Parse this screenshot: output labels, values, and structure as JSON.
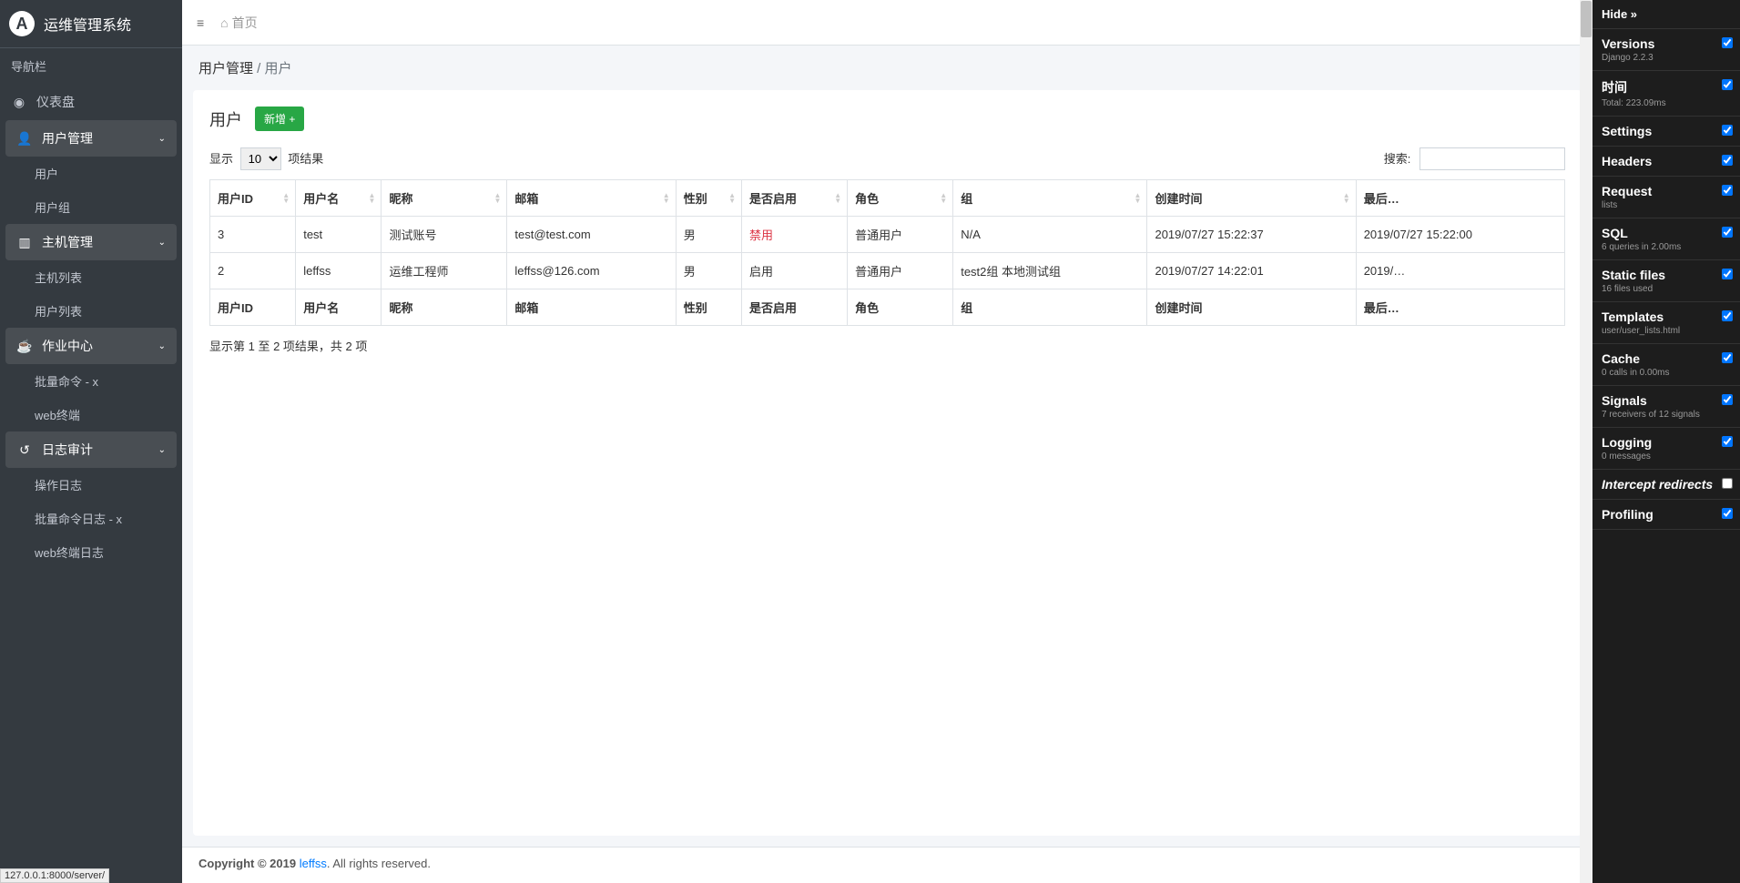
{
  "brand": {
    "title": "运维管理系统"
  },
  "nav_header": "导航栏",
  "nav": {
    "dashboard": "仪表盘",
    "user_mgmt": "用户管理",
    "user_mgmt_items": {
      "users": "用户",
      "groups": "用户组"
    },
    "host_mgmt": "主机管理",
    "host_mgmt_items": {
      "host_list": "主机列表",
      "user_list": "用户列表"
    },
    "job_center": "作业中心",
    "job_center_items": {
      "batch_cmd": "批量命令 - x",
      "web_term": "web终端"
    },
    "log_audit": "日志审计",
    "log_audit_items": {
      "op_log": "操作日志",
      "batch_cmd_log": "批量命令日志 - x",
      "web_term_log": "web终端日志"
    }
  },
  "topbar": {
    "home": "首页"
  },
  "breadcrumb": {
    "parent": "用户管理",
    "sep": " / ",
    "current": "用户"
  },
  "page": {
    "title": "用户",
    "add_btn": "新增 +",
    "show_label_pre": "显示",
    "show_value": "10",
    "show_label_post": "项结果",
    "search_label": "搜索:",
    "info": "显示第 1 至 2 项结果，共 2 项"
  },
  "table": {
    "headers": {
      "user_id": "用户ID",
      "username": "用户名",
      "nickname": "昵称",
      "email": "邮箱",
      "gender": "性别",
      "enabled": "是否启用",
      "role": "角色",
      "group": "组",
      "created": "创建时间",
      "last": "最后…"
    },
    "rows": [
      {
        "user_id": "3",
        "username": "test",
        "nickname": "测试账号",
        "email": "test@test.com",
        "gender": "男",
        "enabled": "禁用",
        "enabled_class": "status-disabled",
        "role": "普通用户",
        "group": "N/A",
        "created": "2019/07/27 15:22:37",
        "last": "2019/07/27 15:22:00"
      },
      {
        "user_id": "2",
        "username": "leffss",
        "nickname": "运维工程师",
        "email": "leffss@126.com",
        "gender": "男",
        "enabled": "启用",
        "enabled_class": "",
        "role": "普通用户",
        "group": "test2组 本地测试组",
        "created": "2019/07/27 14:22:01",
        "last": "2019/…"
      }
    ]
  },
  "footer": {
    "copyright_pre": "Copyright © 2019 ",
    "link": "leffss",
    "copyright_post": ". All rights reserved."
  },
  "status_url": "127.0.0.1:8000/server/",
  "debug": {
    "hide": "Hide »",
    "sections": [
      {
        "title": "Versions",
        "sub": "Django 2.2.3",
        "check": true
      },
      {
        "title": "时间",
        "sub": "Total: 223.09ms",
        "check": true
      },
      {
        "title": "Settings",
        "sub": "",
        "check": true
      },
      {
        "title": "Headers",
        "sub": "",
        "check": true
      },
      {
        "title": "Request",
        "sub": "lists",
        "check": true
      },
      {
        "title": "SQL",
        "sub": "6 queries in 2.00ms",
        "check": true
      },
      {
        "title": "Static files",
        "sub": "16 files used",
        "check": true
      },
      {
        "title": "Templates",
        "sub": "user/user_lists.html",
        "check": true
      },
      {
        "title": "Cache",
        "sub": "0 calls in 0.00ms",
        "check": true
      },
      {
        "title": "Signals",
        "sub": "7 receivers of 12 signals",
        "check": true
      },
      {
        "title": "Logging",
        "sub": "0 messages",
        "check": true
      },
      {
        "title": "Intercept redirects",
        "sub": "",
        "italic": true,
        "check": false
      },
      {
        "title": "Profiling",
        "sub": "",
        "check": true
      }
    ]
  }
}
